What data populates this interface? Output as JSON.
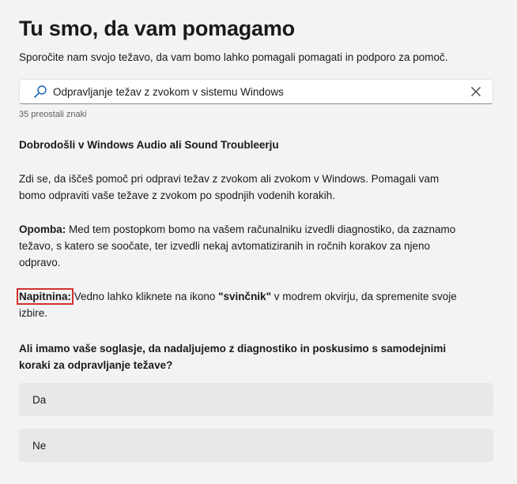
{
  "header": {
    "title": "Tu smo, da vam pomagamo",
    "subtitle": "Sporočite nam svojo težavo, da vam bomo lahko pomagali pomagati in podporo za pomoč."
  },
  "search": {
    "value": "Odpravljanje težav z zvokom v sistemu Windows",
    "icon": "search-icon",
    "clear_icon": "close-icon",
    "remaining": "35 preostali znaki"
  },
  "message": {
    "heading": "Dobrodošli v Windows Audio ali Sound Troubleerju",
    "intro": "Zdi se, da iščeš pomoč pri odpravi težav z zvokom ali zvokom v Windows. Pomagali vam bomo odpraviti vaše težave z zvokom po spodnjih vodenih korakih.",
    "note_label": "Opomba:",
    "note_text": " Med tem postopkom bomo na vašem računalniku izvedli diagnostiko, da zaznamo težavo, s katero se soočate, ter izvedli nekaj avtomatiziranih  in ročnih korakov za njeno odpravo.",
    "tip_label": "Napitnina:",
    "tip_text_1": " Vedno lahko kliknete na ikono ",
    "tip_bold": "\"svinčnik\"",
    "tip_text_2": " v modrem okvirju, da spremenite svoje izbire.",
    "highlight_color": "#d0312d"
  },
  "question": "Ali imamo vaše soglasje, da nadaljujemo z diagnostiko in poskusimo s samodejnimi koraki za odpravljanje težave?",
  "options": [
    {
      "label": "Da"
    },
    {
      "label": "Ne"
    }
  ]
}
